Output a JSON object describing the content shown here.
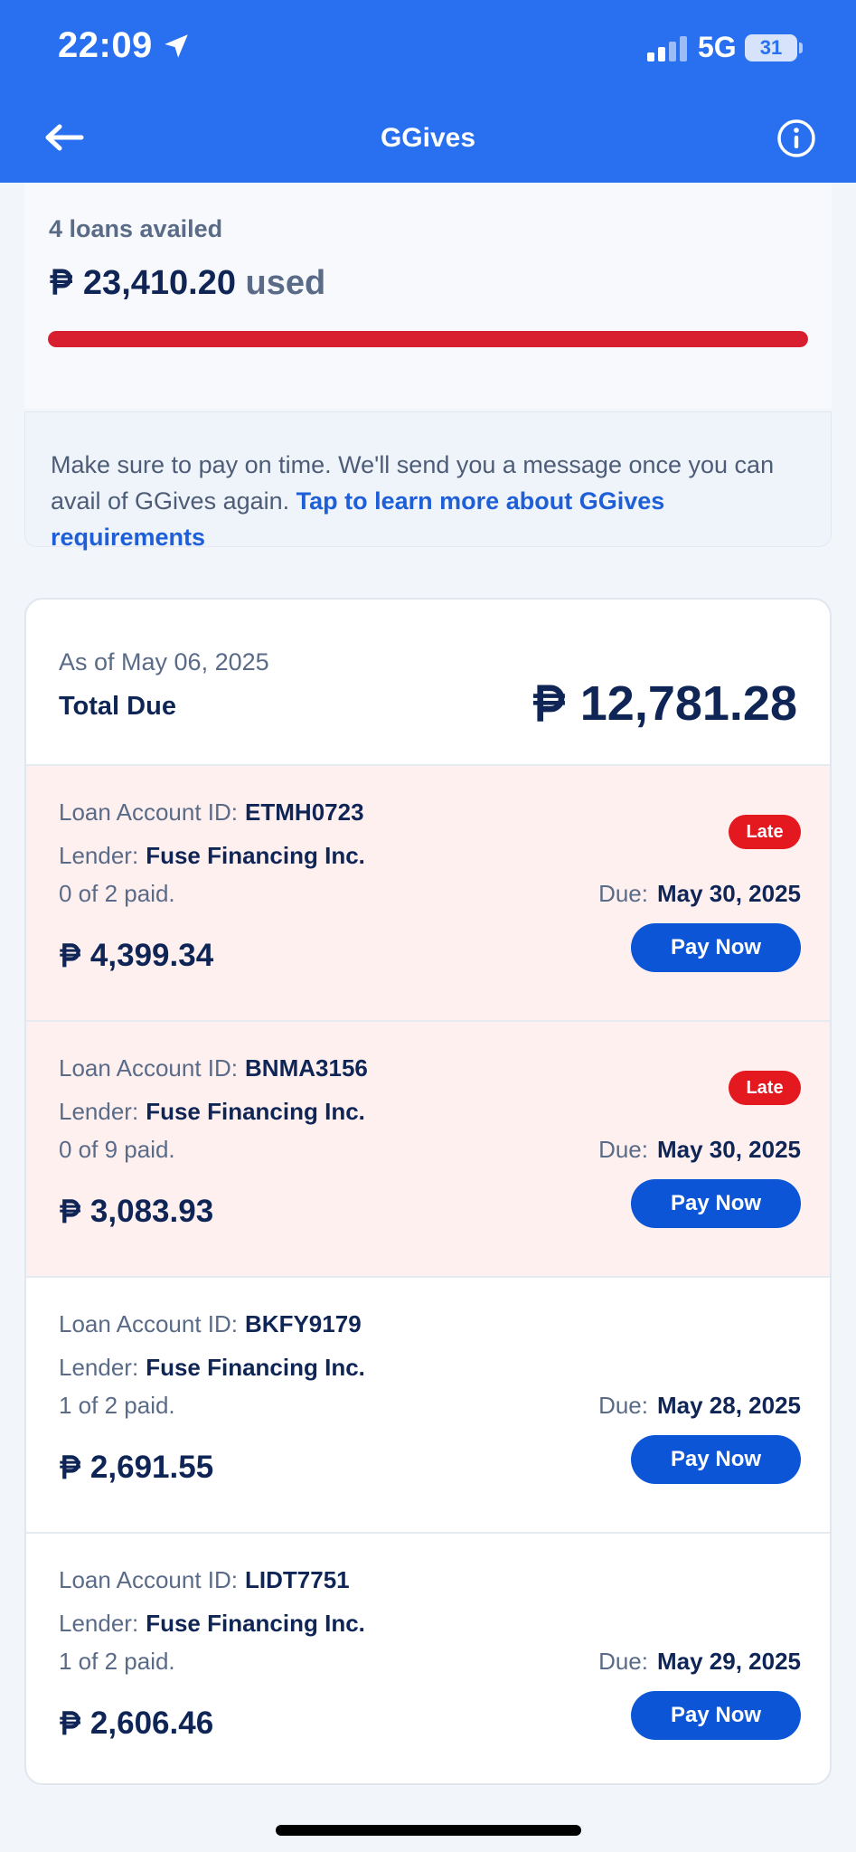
{
  "status_bar": {
    "time": "22:09",
    "network": "5G",
    "battery": "31"
  },
  "header": {
    "title": "GGives",
    "back_icon": "arrow-left-icon",
    "info_icon": "info-circle-icon",
    "background_color": "#2870f0"
  },
  "limit": {
    "loans_availed": "4 loans availed",
    "currency": "₱",
    "used_amount": "23,410.20",
    "used_suffix": "used",
    "usage_fraction": 1.0,
    "bar_color": "#d81f30"
  },
  "notice": {
    "text": "Make sure to pay on time. We'll send you a message once you can avail of GGives again.",
    "link": "Tap to learn more about GGives requirements"
  },
  "summary": {
    "as_of": "As of May 06, 2025",
    "total_label": "Total Due",
    "total_amount": "12,781.28"
  },
  "labels": {
    "loan_account_id": "Loan Account ID:",
    "lender": "Lender:",
    "due": "Due:",
    "pay_now": "Pay Now",
    "late": "Late"
  },
  "loans": [
    {
      "account_id": "ETMH0723",
      "lender": "Fuse Financing Inc.",
      "paid": "0 of 2 paid.",
      "due_date": "May 30, 2025",
      "amount": "4,399.34",
      "late": true
    },
    {
      "account_id": "BNMA3156",
      "lender": "Fuse Financing Inc.",
      "paid": "0 of 9 paid.",
      "due_date": "May 30, 2025",
      "amount": "3,083.93",
      "late": true
    },
    {
      "account_id": "BKFY9179",
      "lender": "Fuse Financing Inc.",
      "paid": "1 of 2 paid.",
      "due_date": "May 28, 2025",
      "amount": "2,691.55",
      "late": false
    },
    {
      "account_id": "LIDT7751",
      "lender": "Fuse Financing Inc.",
      "paid": "1 of 2 paid.",
      "due_date": "May 29, 2025",
      "amount": "2,606.46",
      "late": false
    }
  ],
  "colors": {
    "primary": "#0b55d6",
    "late_badge": "#e4181f",
    "late_row_background": "#fff0f0",
    "text_dark": "#0f2556"
  }
}
